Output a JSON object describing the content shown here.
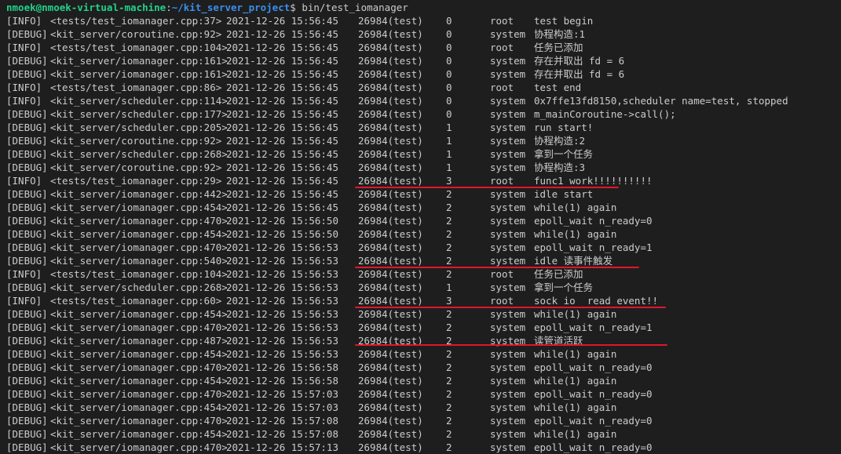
{
  "prompt": {
    "user_host": "nmoek@nmoek-virtual-machine",
    "sep": ":",
    "path": "~/kit_server_project",
    "symbol": "$",
    "command": "bin/test_iomanager"
  },
  "colors": {
    "background": "#1e1e1e",
    "text": "#cccccc",
    "prompt_user": "#23d18b",
    "prompt_path": "#3b8eea",
    "underline": "#e0172b"
  },
  "log_rows": [
    {
      "level": "[INFO]",
      "file": "<tests/test_iomanager.cpp:37>",
      "time": "2021-12-26 15:56:45",
      "pid": "26984(test)",
      "coroutine": "0",
      "logger": "root",
      "message": "test begin"
    },
    {
      "level": "[DEBUG]",
      "file": "<kit_server/coroutine.cpp:92>",
      "time": "2021-12-26 15:56:45",
      "pid": "26984(test)",
      "coroutine": "0",
      "logger": "system",
      "message": "协程构造:1"
    },
    {
      "level": "[INFO]",
      "file": "<tests/test_iomanager.cpp:104>",
      "time": "2021-12-26 15:56:45",
      "pid": "26984(test)",
      "coroutine": "0",
      "logger": "root",
      "message": "任务已添加"
    },
    {
      "level": "[DEBUG]",
      "file": "<kit_server/iomanager.cpp:161>",
      "time": "2021-12-26 15:56:45",
      "pid": "26984(test)",
      "coroutine": "0",
      "logger": "system",
      "message": "存在并取出 fd = 6"
    },
    {
      "level": "[DEBUG]",
      "file": "<kit_server/iomanager.cpp:161>",
      "time": "2021-12-26 15:56:45",
      "pid": "26984(test)",
      "coroutine": "0",
      "logger": "system",
      "message": "存在并取出 fd = 6"
    },
    {
      "level": "[INFO]",
      "file": "<tests/test_iomanager.cpp:86>",
      "time": "2021-12-26 15:56:45",
      "pid": "26984(test)",
      "coroutine": "0",
      "logger": "root",
      "message": "test end"
    },
    {
      "level": "[INFO]",
      "file": "<kit_server/scheduler.cpp:114>",
      "time": "2021-12-26 15:56:45",
      "pid": "26984(test)",
      "coroutine": "0",
      "logger": "system",
      "message": "0x7ffe13fd8150,scheduler name=test, stopped"
    },
    {
      "level": "[DEBUG]",
      "file": "<kit_server/scheduler.cpp:177>",
      "time": "2021-12-26 15:56:45",
      "pid": "26984(test)",
      "coroutine": "0",
      "logger": "system",
      "message": "m_mainCoroutine->call();"
    },
    {
      "level": "[DEBUG]",
      "file": "<kit_server/scheduler.cpp:205>",
      "time": "2021-12-26 15:56:45",
      "pid": "26984(test)",
      "coroutine": "1",
      "logger": "system",
      "message": "run start!"
    },
    {
      "level": "[DEBUG]",
      "file": "<kit_server/coroutine.cpp:92>",
      "time": "2021-12-26 15:56:45",
      "pid": "26984(test)",
      "coroutine": "1",
      "logger": "system",
      "message": "协程构造:2"
    },
    {
      "level": "[DEBUG]",
      "file": "<kit_server/scheduler.cpp:268>",
      "time": "2021-12-26 15:56:45",
      "pid": "26984(test)",
      "coroutine": "1",
      "logger": "system",
      "message": "拿到一个任务"
    },
    {
      "level": "[DEBUG]",
      "file": "<kit_server/coroutine.cpp:92>",
      "time": "2021-12-26 15:56:45",
      "pid": "26984(test)",
      "coroutine": "1",
      "logger": "system",
      "message": "协程构造:3"
    },
    {
      "level": "[INFO]",
      "file": "<tests/test_iomanager.cpp:29>",
      "time": "2021-12-26 15:56:45",
      "pid": "26984(test)",
      "coroutine": "3",
      "logger": "root",
      "message": "func1 work!!!!!!!!!!"
    },
    {
      "level": "[DEBUG]",
      "file": "<kit_server/iomanager.cpp:442>",
      "time": "2021-12-26 15:56:45",
      "pid": "26984(test)",
      "coroutine": "2",
      "logger": "system",
      "message": "idle start"
    },
    {
      "level": "[DEBUG]",
      "file": "<kit_server/iomanager.cpp:454>",
      "time": "2021-12-26 15:56:45",
      "pid": "26984(test)",
      "coroutine": "2",
      "logger": "system",
      "message": "while(1) again"
    },
    {
      "level": "[DEBUG]",
      "file": "<kit_server/iomanager.cpp:470>",
      "time": "2021-12-26 15:56:50",
      "pid": "26984(test)",
      "coroutine": "2",
      "logger": "system",
      "message": "epoll_wait n_ready=0"
    },
    {
      "level": "[DEBUG]",
      "file": "<kit_server/iomanager.cpp:454>",
      "time": "2021-12-26 15:56:50",
      "pid": "26984(test)",
      "coroutine": "2",
      "logger": "system",
      "message": "while(1) again"
    },
    {
      "level": "[DEBUG]",
      "file": "<kit_server/iomanager.cpp:470>",
      "time": "2021-12-26 15:56:53",
      "pid": "26984(test)",
      "coroutine": "2",
      "logger": "system",
      "message": "epoll_wait n_ready=1"
    },
    {
      "level": "[DEBUG]",
      "file": "<kit_server/iomanager.cpp:540>",
      "time": "2021-12-26 15:56:53",
      "pid": "26984(test)",
      "coroutine": "2",
      "logger": "system",
      "message": "idle 读事件触发"
    },
    {
      "level": "[INFO]",
      "file": "<tests/test_iomanager.cpp:104>",
      "time": "2021-12-26 15:56:53",
      "pid": "26984(test)",
      "coroutine": "2",
      "logger": "root",
      "message": "任务已添加"
    },
    {
      "level": "[DEBUG]",
      "file": "<kit_server/scheduler.cpp:268>",
      "time": "2021-12-26 15:56:53",
      "pid": "26984(test)",
      "coroutine": "1",
      "logger": "system",
      "message": "拿到一个任务"
    },
    {
      "level": "[INFO]",
      "file": "<tests/test_iomanager.cpp:60>",
      "time": "2021-12-26 15:56:53",
      "pid": "26984(test)",
      "coroutine": "3",
      "logger": "root",
      "message": "sock io  read event!!"
    },
    {
      "level": "[DEBUG]",
      "file": "<kit_server/iomanager.cpp:454>",
      "time": "2021-12-26 15:56:53",
      "pid": "26984(test)",
      "coroutine": "2",
      "logger": "system",
      "message": "while(1) again"
    },
    {
      "level": "[DEBUG]",
      "file": "<kit_server/iomanager.cpp:470>",
      "time": "2021-12-26 15:56:53",
      "pid": "26984(test)",
      "coroutine": "2",
      "logger": "system",
      "message": "epoll_wait n_ready=1"
    },
    {
      "level": "[DEBUG]",
      "file": "<kit_server/iomanager.cpp:487>",
      "time": "2021-12-26 15:56:53",
      "pid": "26984(test)",
      "coroutine": "2",
      "logger": "system",
      "message": "读管道活跃"
    },
    {
      "level": "[DEBUG]",
      "file": "<kit_server/iomanager.cpp:454>",
      "time": "2021-12-26 15:56:53",
      "pid": "26984(test)",
      "coroutine": "2",
      "logger": "system",
      "message": "while(1) again"
    },
    {
      "level": "[DEBUG]",
      "file": "<kit_server/iomanager.cpp:470>",
      "time": "2021-12-26 15:56:58",
      "pid": "26984(test)",
      "coroutine": "2",
      "logger": "system",
      "message": "epoll_wait n_ready=0"
    },
    {
      "level": "[DEBUG]",
      "file": "<kit_server/iomanager.cpp:454>",
      "time": "2021-12-26 15:56:58",
      "pid": "26984(test)",
      "coroutine": "2",
      "logger": "system",
      "message": "while(1) again"
    },
    {
      "level": "[DEBUG]",
      "file": "<kit_server/iomanager.cpp:470>",
      "time": "2021-12-26 15:57:03",
      "pid": "26984(test)",
      "coroutine": "2",
      "logger": "system",
      "message": "epoll_wait n_ready=0"
    },
    {
      "level": "[DEBUG]",
      "file": "<kit_server/iomanager.cpp:454>",
      "time": "2021-12-26 15:57:03",
      "pid": "26984(test)",
      "coroutine": "2",
      "logger": "system",
      "message": "while(1) again"
    },
    {
      "level": "[DEBUG]",
      "file": "<kit_server/iomanager.cpp:470>",
      "time": "2021-12-26 15:57:08",
      "pid": "26984(test)",
      "coroutine": "2",
      "logger": "system",
      "message": "epoll_wait n_ready=0"
    },
    {
      "level": "[DEBUG]",
      "file": "<kit_server/iomanager.cpp:454>",
      "time": "2021-12-26 15:57:08",
      "pid": "26984(test)",
      "coroutine": "2",
      "logger": "system",
      "message": "while(1) again"
    },
    {
      "level": "[DEBUG]",
      "file": "<kit_server/iomanager.cpp:470>",
      "time": "2021-12-26 15:57:13",
      "pid": "26984(test)",
      "coroutine": "2",
      "logger": "system",
      "message": "epoll_wait n_ready=0"
    }
  ],
  "highlighted_rows": [
    12,
    18,
    21,
    24
  ]
}
